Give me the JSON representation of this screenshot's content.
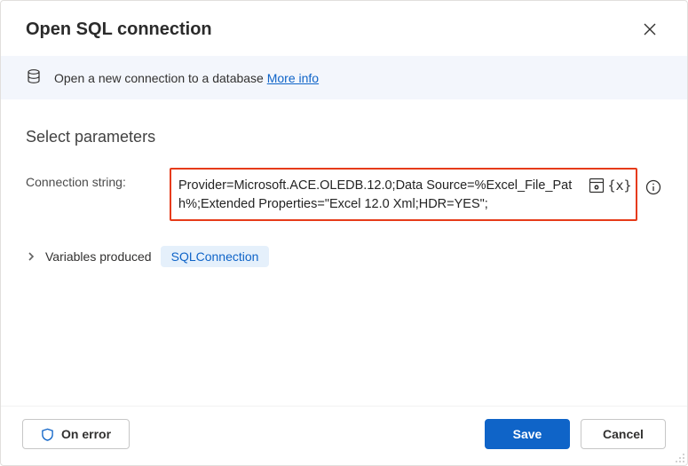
{
  "header": {
    "title": "Open SQL connection"
  },
  "infobar": {
    "text": "Open a new connection to a database ",
    "link": "More info"
  },
  "section": {
    "title": "Select parameters"
  },
  "param": {
    "label": "Connection string:",
    "value": "Provider=Microsoft.ACE.OLEDB.12.0;Data Source=%Excel_File_Path%;Extended Properties=\"Excel 12.0 Xml;HDR=YES\";"
  },
  "variables": {
    "label": "Variables produced",
    "badge": "SQLConnection"
  },
  "footer": {
    "on_error": "On error",
    "save": "Save",
    "cancel": "Cancel"
  }
}
